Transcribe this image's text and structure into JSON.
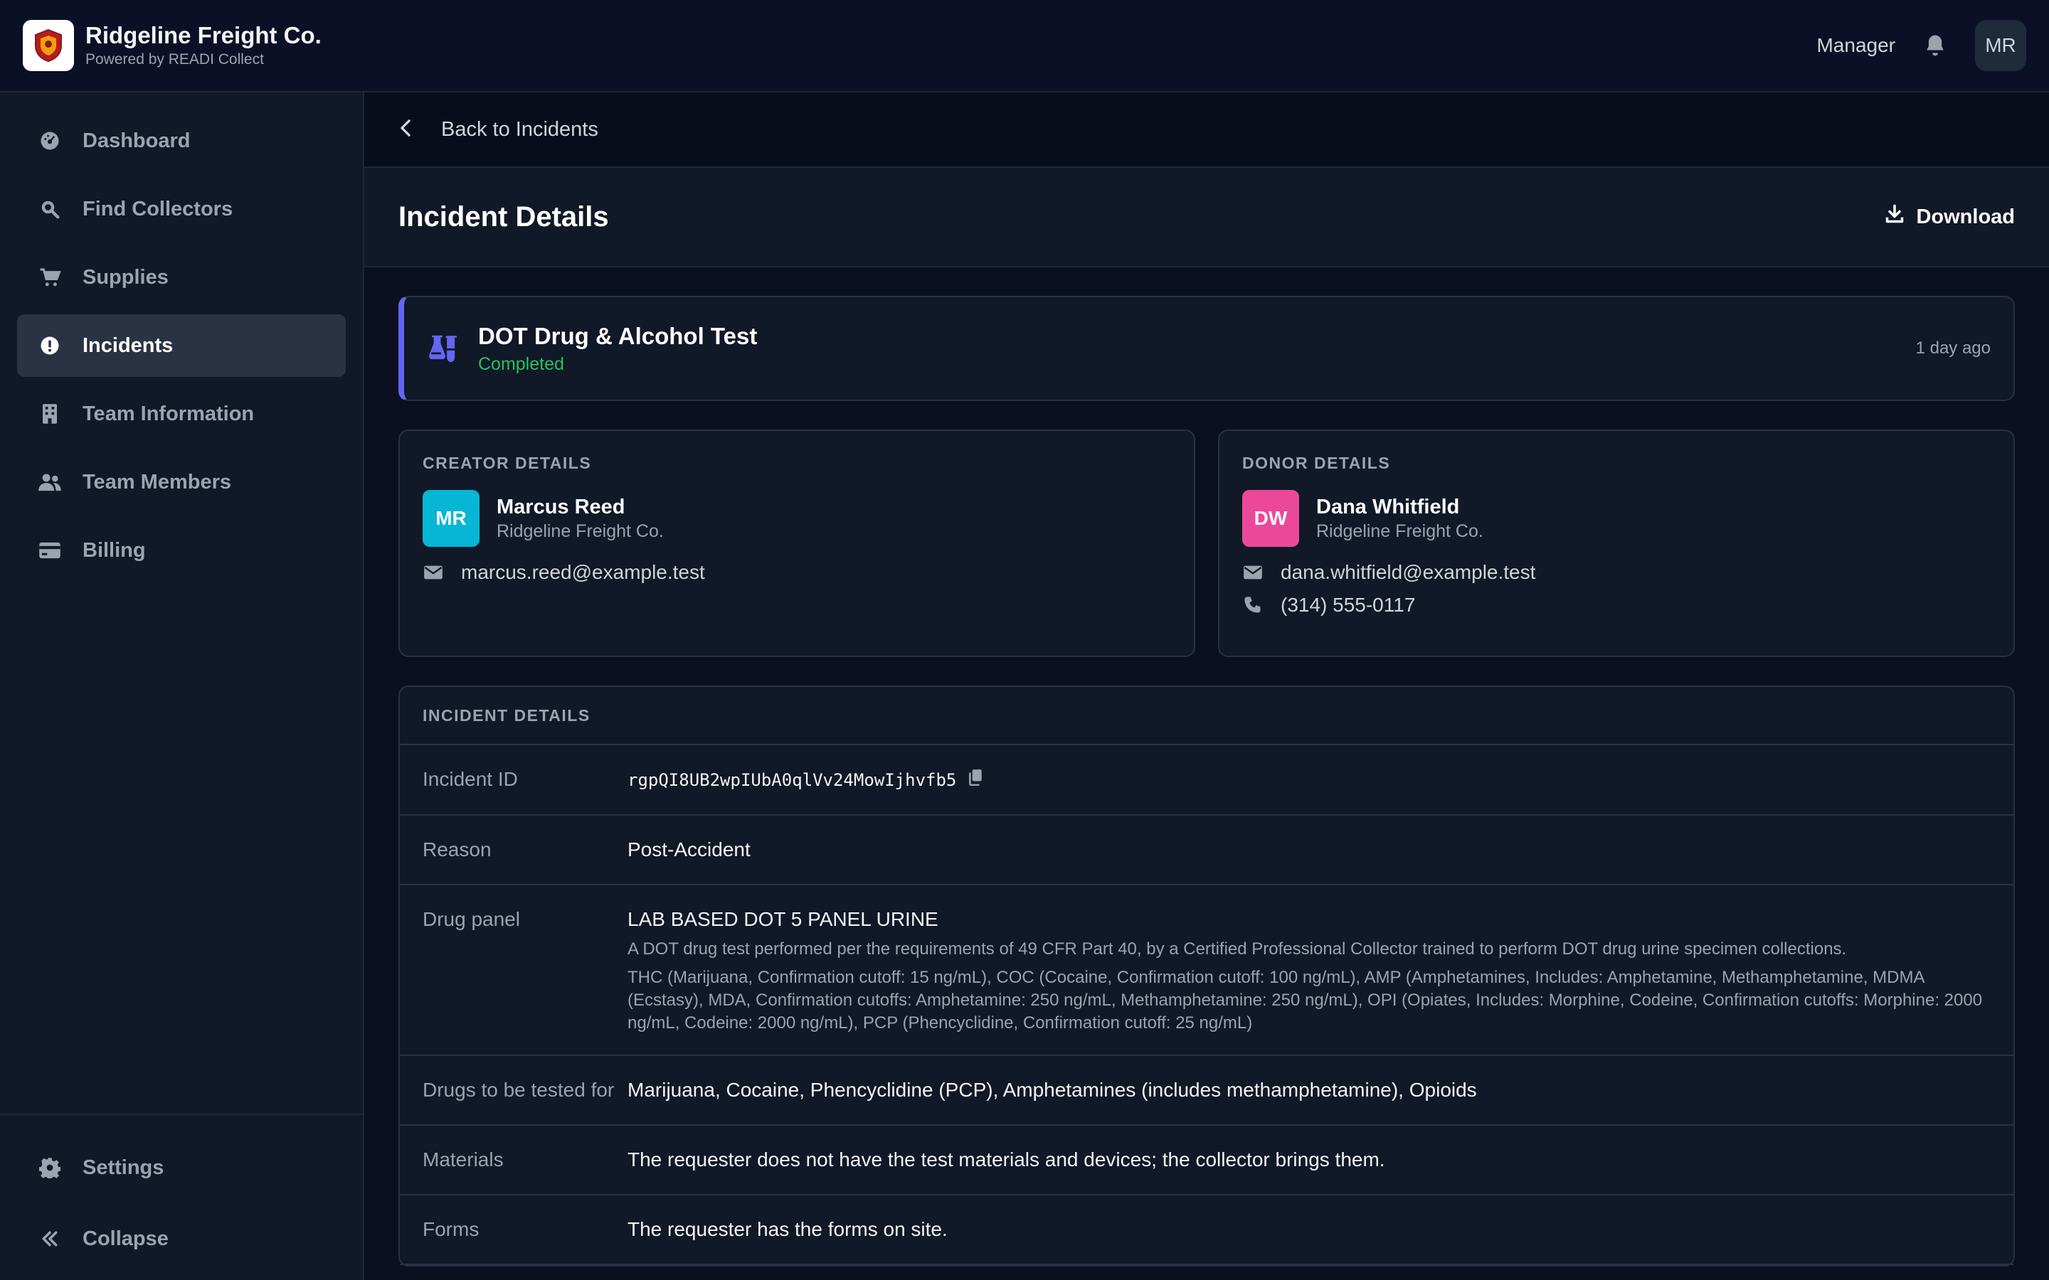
{
  "app": {
    "brand_name": "Ridgeline Freight Co.",
    "brand_sub": "Powered by READI Collect",
    "role": "Manager",
    "user_initials": "MR"
  },
  "sidebar": {
    "items": [
      {
        "label": "Dashboard",
        "icon": "dashboard-icon"
      },
      {
        "label": "Find Collectors",
        "icon": "search-icon"
      },
      {
        "label": "Supplies",
        "icon": "cart-icon"
      },
      {
        "label": "Incidents",
        "icon": "alert-icon",
        "active": true
      },
      {
        "label": "Team Information",
        "icon": "building-icon"
      },
      {
        "label": "Team Members",
        "icon": "users-icon"
      },
      {
        "label": "Billing",
        "icon": "credit-card-icon"
      }
    ],
    "settings": "Settings",
    "collapse": "Collapse"
  },
  "main": {
    "back_label": "Back to Incidents",
    "title": "Incident Details",
    "download": "Download",
    "summary": {
      "title": "DOT Drug & Alcohol Test",
      "status": "Completed",
      "time": "1 day ago"
    },
    "creator": {
      "heading": "CREATOR DETAILS",
      "initials": "MR",
      "name": "Marcus Reed",
      "org": "Ridgeline Freight Co.",
      "email": "marcus.reed@example.test"
    },
    "donor": {
      "heading": "DONOR DETAILS",
      "initials": "DW",
      "name": "Dana Whitfield",
      "org": "Ridgeline Freight Co.",
      "email": "dana.whitfield@example.test",
      "phone": "(314) 555-0117"
    },
    "details": {
      "heading": "INCIDENT DETAILS",
      "incident_id_label": "Incident ID",
      "incident_id": "rgpQI8UB2wpIUbA0qlVv24MowIjhvfb5",
      "reason_label": "Reason",
      "reason": "Post-Accident",
      "panel_label": "Drug panel",
      "panel_name": "LAB BASED DOT 5 PANEL URINE",
      "panel_desc": "A DOT drug test performed per the requirements of 49 CFR Part 40, by a Certified Professional Collector trained to perform DOT drug urine specimen collections.",
      "panel_list": "THC (Marijuana, Confirmation cutoff: 15 ng/mL), COC (Cocaine, Confirmation cutoff: 100 ng/mL), AMP (Amphetamines, Includes: Amphetamine, Methamphetamine, MDMA (Ecstasy), MDA, Confirmation cutoffs: Amphetamine: 250 ng/mL, Methamphetamine: 250 ng/mL), OPI (Opiates, Includes: Morphine, Codeine, Confirmation cutoffs: Morphine: 2000 ng/mL, Codeine: 2000 ng/mL), PCP (Phencyclidine, Confirmation cutoff: 25 ng/mL)",
      "drugs_label": "Drugs to be tested for",
      "drugs": "Marijuana, Cocaine, Phencyclidine (PCP), Amphetamines (includes methamphetamine), Opioids",
      "materials_label": "Materials",
      "materials": "The requester does not have the test materials and devices; the collector brings them.",
      "forms_label": "Forms",
      "forms": "The requester has the forms on site."
    }
  },
  "colors": {
    "accent": "#6366f1",
    "status_completed": "#22c55e",
    "creator_avatar": "#06b6d4",
    "donor_avatar": "#ec4899"
  }
}
